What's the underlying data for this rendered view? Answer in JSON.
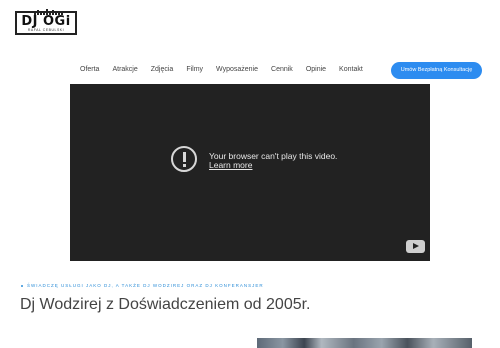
{
  "logo": {
    "main": "DJ OGi",
    "sub": "RAFAL CEBULSKI"
  },
  "nav": {
    "items": [
      "Oferta",
      "Atrakcje",
      "Zdjęcia",
      "Filmy",
      "Wyposażenie",
      "Cennik",
      "Opinie",
      "Kontakt"
    ],
    "cta_label": "Umów Bezpłatną Konsultację"
  },
  "video": {
    "message": "Your browser can't play this video.",
    "link": "Learn more",
    "icon": "youtube-icon"
  },
  "intro": {
    "eyebrow": "ŚWIADCZĘ USŁUGI JAKO DJ, A TAKŻE DJ WODZIREJ ORAZ DJ KONFERANSJER",
    "heading": "Dj Wodzirej z Doświadczeniem od 2005r."
  },
  "colors": {
    "accent": "#2d8cf0",
    "video_bg": "#222222",
    "eyebrow": "#2f8fd8"
  }
}
